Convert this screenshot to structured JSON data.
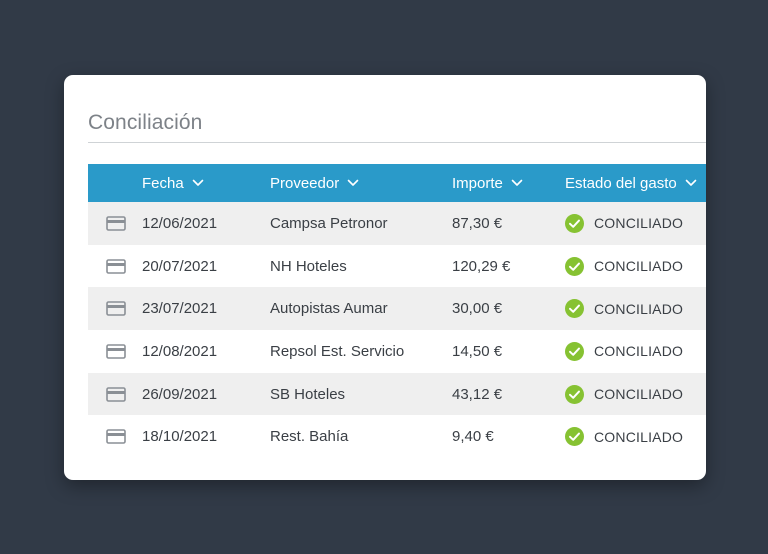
{
  "header": {
    "title": "Conciliación"
  },
  "colors": {
    "background": "#313a47",
    "header_bg": "#2a9ac9",
    "row_shaded": "#efefef",
    "success": "#86c232"
  },
  "table": {
    "columns": [
      {
        "key": "fecha",
        "label": "Fecha"
      },
      {
        "key": "proveedor",
        "label": "Proveedor"
      },
      {
        "key": "importe",
        "label": "Importe"
      },
      {
        "key": "estado",
        "label": "Estado del gasto"
      }
    ],
    "rows": [
      {
        "icon": "credit-card-icon",
        "fecha": "12/06/2021",
        "proveedor": "Campsa Petronor",
        "importe": "87,30 €",
        "estado": "CONCILIADO"
      },
      {
        "icon": "credit-card-icon",
        "fecha": "20/07/2021",
        "proveedor": "NH Hoteles",
        "importe": "120,29 €",
        "estado": "CONCILIADO"
      },
      {
        "icon": "credit-card-icon",
        "fecha": "23/07/2021",
        "proveedor": "Autopistas Aumar",
        "importe": "30,00 €",
        "estado": "CONCILIADO"
      },
      {
        "icon": "credit-card-icon",
        "fecha": "12/08/2021",
        "proveedor": "Repsol Est. Servicio",
        "importe": "14,50 €",
        "estado": "CONCILIADO"
      },
      {
        "icon": "credit-card-icon",
        "fecha": "26/09/2021",
        "proveedor": "SB Hoteles",
        "importe": "43,12 €",
        "estado": "CONCILIADO"
      },
      {
        "icon": "credit-card-icon",
        "fecha": "18/10/2021",
        "proveedor": "Rest. Bahía",
        "importe": "9,40 €",
        "estado": "CONCILIADO"
      }
    ]
  }
}
